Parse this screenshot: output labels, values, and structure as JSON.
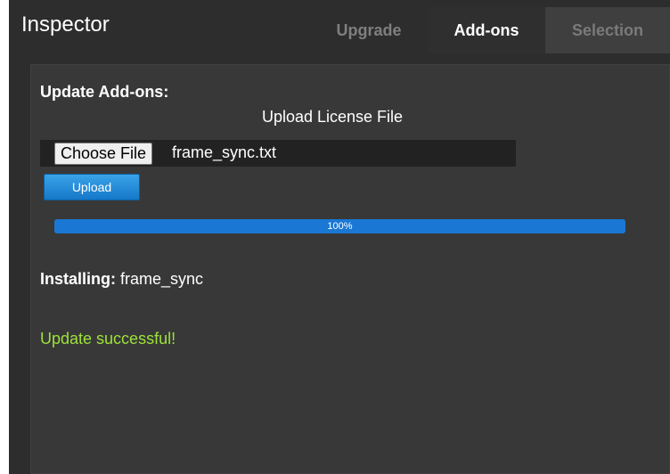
{
  "header": {
    "title": "Inspector",
    "tabs": [
      {
        "label": "Upgrade",
        "active": false
      },
      {
        "label": "Add-ons",
        "active": true
      },
      {
        "label": "Selection",
        "active": false
      }
    ]
  },
  "addons": {
    "section_title": "Update Add-ons:",
    "upload_label": "Upload License File",
    "choose_file_label": "Choose File",
    "file_name": "frame_sync.txt",
    "upload_button": "Upload",
    "progress": {
      "value": 100,
      "label": "100%"
    },
    "installing_label": "Installing:",
    "installing_value": "frame_sync",
    "status_message": "Update successful!"
  },
  "colors": {
    "success": "#9de23a",
    "progress_fill": "#1a78d4",
    "accent": "#1578c9"
  }
}
